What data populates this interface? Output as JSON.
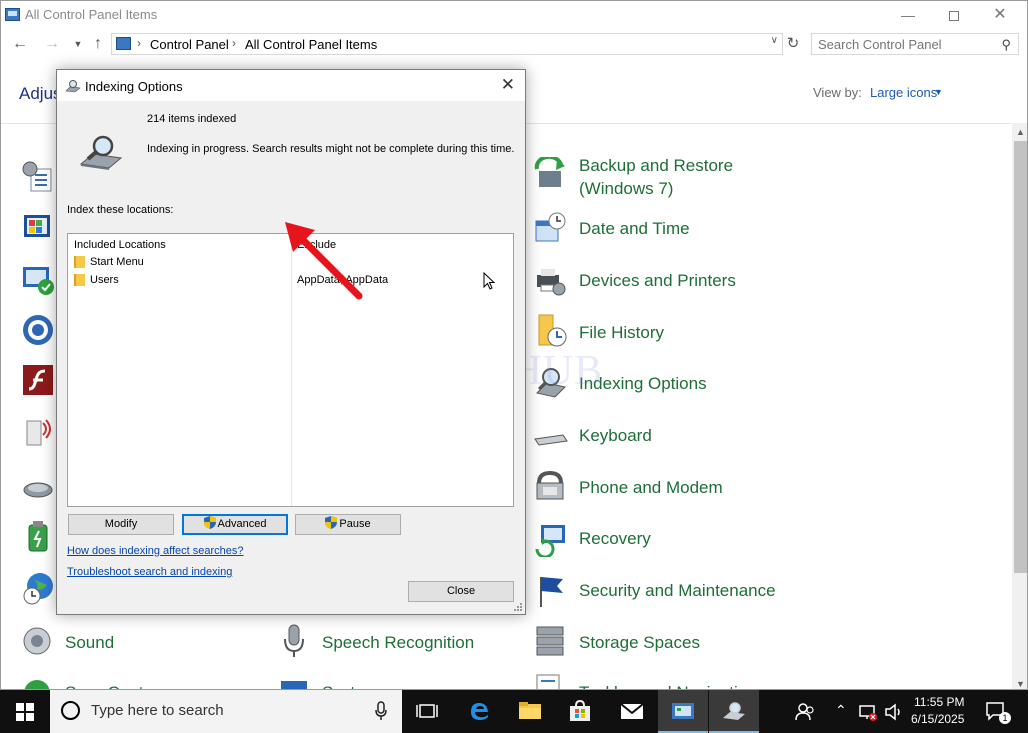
{
  "window": {
    "title": "All Control Panel Items",
    "breadcrumb": [
      "Control Panel",
      "All Control Panel Items"
    ],
    "search_placeholder": "Search Control Panel",
    "heading_partial": "Adjus",
    "view_by_label": "View by:",
    "view_by_value": "Large icons"
  },
  "items_right": [
    {
      "label": "Backup and Restore (Windows 7)",
      "icon": "backup-restore-icon"
    },
    {
      "label": "Date and Time",
      "icon": "date-time-icon"
    },
    {
      "label": "Devices and Printers",
      "icon": "devices-printers-icon"
    },
    {
      "label": "File History",
      "icon": "file-history-icon"
    },
    {
      "label": "Indexing Options",
      "icon": "indexing-options-icon"
    },
    {
      "label": "Keyboard",
      "icon": "keyboard-icon"
    },
    {
      "label": "Phone and Modem",
      "icon": "phone-modem-icon"
    },
    {
      "label": "Recovery",
      "icon": "recovery-icon"
    },
    {
      "label": "Security and Maintenance",
      "icon": "security-maintenance-icon"
    },
    {
      "label": "Storage Spaces",
      "icon": "storage-spaces-icon"
    },
    {
      "label": "Taskbar and Navigation",
      "icon": "taskbar-navigation-icon"
    }
  ],
  "items_bottom": [
    {
      "label": "Sound",
      "icon": "sound-icon"
    },
    {
      "label": "Speech Recognition",
      "icon": "speech-recognition-icon"
    },
    {
      "label": "Sync Center",
      "icon": "sync-center-icon"
    },
    {
      "label": "System",
      "icon": "system-icon"
    }
  ],
  "dialog": {
    "title": "Indexing Options",
    "items_indexed": "214 items indexed",
    "status": "Indexing in progress. Search results might not be complete during this time.",
    "index_label": "Index these locations:",
    "col_included": "Included Locations",
    "col_exclude": "Exclude",
    "locations": [
      {
        "name": "Start Menu",
        "exclude": ""
      },
      {
        "name": "Users",
        "exclude": "AppData; AppData"
      }
    ],
    "buttons": {
      "modify": "Modify",
      "advanced": "Advanced",
      "pause": "Pause",
      "close": "Close"
    },
    "link_how": "How does indexing affect searches?",
    "link_troubleshoot": "Troubleshoot search and indexing"
  },
  "watermark": "IT Pros HUB",
  "taskbar": {
    "search_placeholder": "Type here to search",
    "time": "11:55 PM",
    "date": "6/15/2025",
    "notification_count": "1"
  },
  "colors": {
    "link_green": "#1e6e37",
    "heading_blue": "#1e3287",
    "accent": "#0078d7",
    "taskbar": "#101010"
  }
}
